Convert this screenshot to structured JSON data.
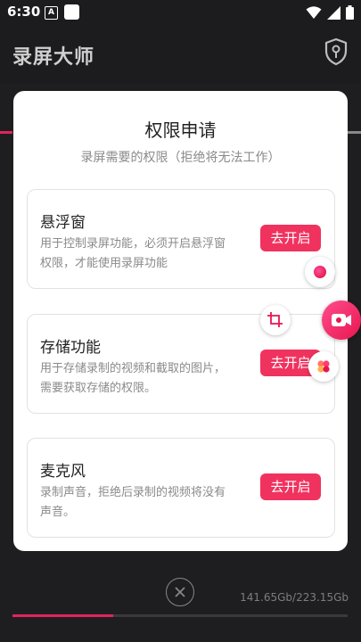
{
  "status_bar": {
    "time": "6:30",
    "notification_letter": "A",
    "icons": [
      "notification-a-icon",
      "square-icon",
      "wifi-icon",
      "signal-icon",
      "battery-icon"
    ]
  },
  "app_bar": {
    "title": "录屏大师",
    "action_icon": "shield-key-icon"
  },
  "dialog": {
    "title": "权限申请",
    "subtitle": "录屏需要的权限（拒绝将无法工作）",
    "cards": [
      {
        "title": "悬浮窗",
        "description": "用于控制录屏功能，必须开启悬浮窗权限，才能使用录屏功能",
        "button": "去开启"
      },
      {
        "title": "存储功能",
        "description": "用于存储录制的视频和截取的图片，需要获取存储的权限。",
        "button": "去开启"
      },
      {
        "title": "麦克风",
        "description": "录制声音，拒绝后录制的视频将没有声音。",
        "button": "去开启"
      }
    ]
  },
  "floating_tools": [
    "record-dot-icon",
    "crop-icon",
    "video-camera-icon",
    "flower-icon"
  ],
  "bottom": {
    "close_icon": "close-circle-icon",
    "storage": "141.65Gb/223.15Gb",
    "storage_used_fraction": 0.3
  },
  "colors": {
    "accent": "#f0325f",
    "background": "#1c1c1e",
    "dialog": "#ffffff"
  }
}
